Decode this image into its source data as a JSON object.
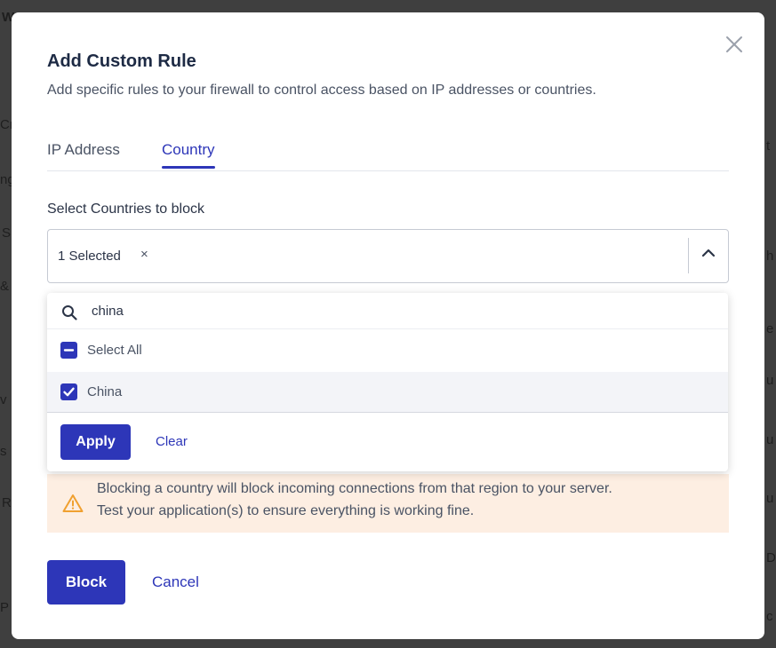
{
  "background": {
    "fragments": [
      "W",
      "Cr",
      "ng",
      "S",
      "&",
      "v",
      "s",
      "R",
      "P",
      "t",
      "h",
      "e",
      "u",
      "u",
      "u",
      "D",
      "c"
    ]
  },
  "modal": {
    "title": "Add Custom Rule",
    "subtitle": "Add specific rules to your firewall to control access based on IP addresses or countries.",
    "close_icon": "close-icon"
  },
  "tabs": [
    {
      "label": "IP Address",
      "active": false
    },
    {
      "label": "Country",
      "active": true
    }
  ],
  "country_select": {
    "label": "Select Countries to block",
    "selected_text": "1 Selected",
    "clear_symbol": "×",
    "state": "open"
  },
  "dropdown": {
    "search_value": "china",
    "options": [
      {
        "label": "Select All",
        "state": "indeterminate"
      },
      {
        "label": "China",
        "state": "checked"
      }
    ],
    "apply_label": "Apply",
    "clear_label": "Clear"
  },
  "warning": {
    "line1": "Blocking a country will block incoming connections from that region to your server.",
    "line2": "Test your application(s) to ensure everything is working fine.",
    "icon": "warning-triangle-icon"
  },
  "actions": {
    "block_label": "Block",
    "cancel_label": "Cancel"
  },
  "colors": {
    "primary": "#2d36b8",
    "warning_bg": "#fdeee2",
    "warning_icon": "#f0a030",
    "overlay": "#3f3f3f"
  }
}
